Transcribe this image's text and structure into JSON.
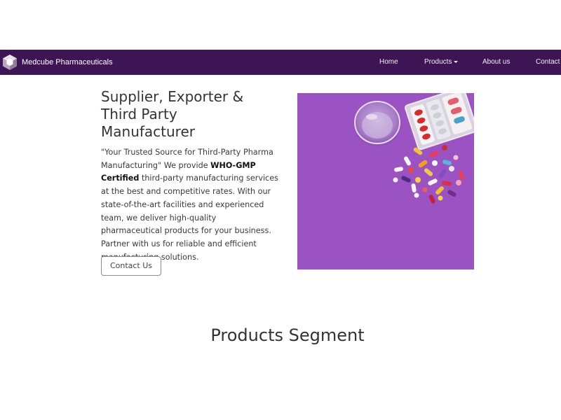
{
  "navbar": {
    "brand_name": "Medcube Pharmaceuticals",
    "brand_logo_icon": "cube-logo",
    "background_color": "#3d1454",
    "items": [
      {
        "label": "Home"
      },
      {
        "label": "Products",
        "has_dropdown": true
      },
      {
        "label": "About us"
      },
      {
        "label": "Contact u"
      }
    ]
  },
  "hero": {
    "title": "Supplier, Exporter & Third Party Manufacturer",
    "text_before": "\"Your Trusted Source for Third-Party Pharma Manufacturing\" We provide ",
    "text_bold": "WHO-GMP Certified",
    "text_after": " third-party manufacturing services at the best and competitive rates. With our state-of-the-art facilities and experienced team, we deliver high-quality pharmaceutical products for your business. Partner with us for reliable and efficient manufacturing solutions.",
    "button_label": "Contact Us",
    "image": {
      "subject": "pills-and-water-glass",
      "background_color": "#9b52c2"
    }
  },
  "products_section": {
    "title": "Products Segment"
  }
}
